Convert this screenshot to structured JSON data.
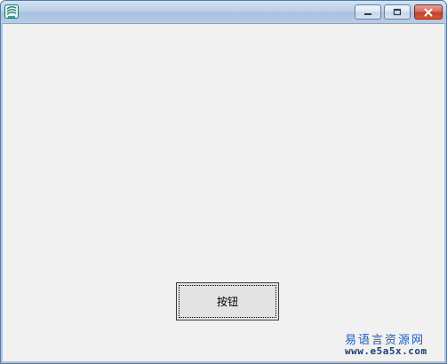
{
  "window": {
    "title": "",
    "icon": "app-icon",
    "controls": {
      "minimize_icon": "minimize-icon",
      "maximize_icon": "maximize-icon",
      "close_icon": "close-icon"
    },
    "accent_close": "#c2412c",
    "client_bg": "#f1f1f1"
  },
  "client": {
    "button_label": "按钮"
  },
  "watermark": {
    "title": "易语言资源网",
    "url": "www.e5a5x.com"
  }
}
